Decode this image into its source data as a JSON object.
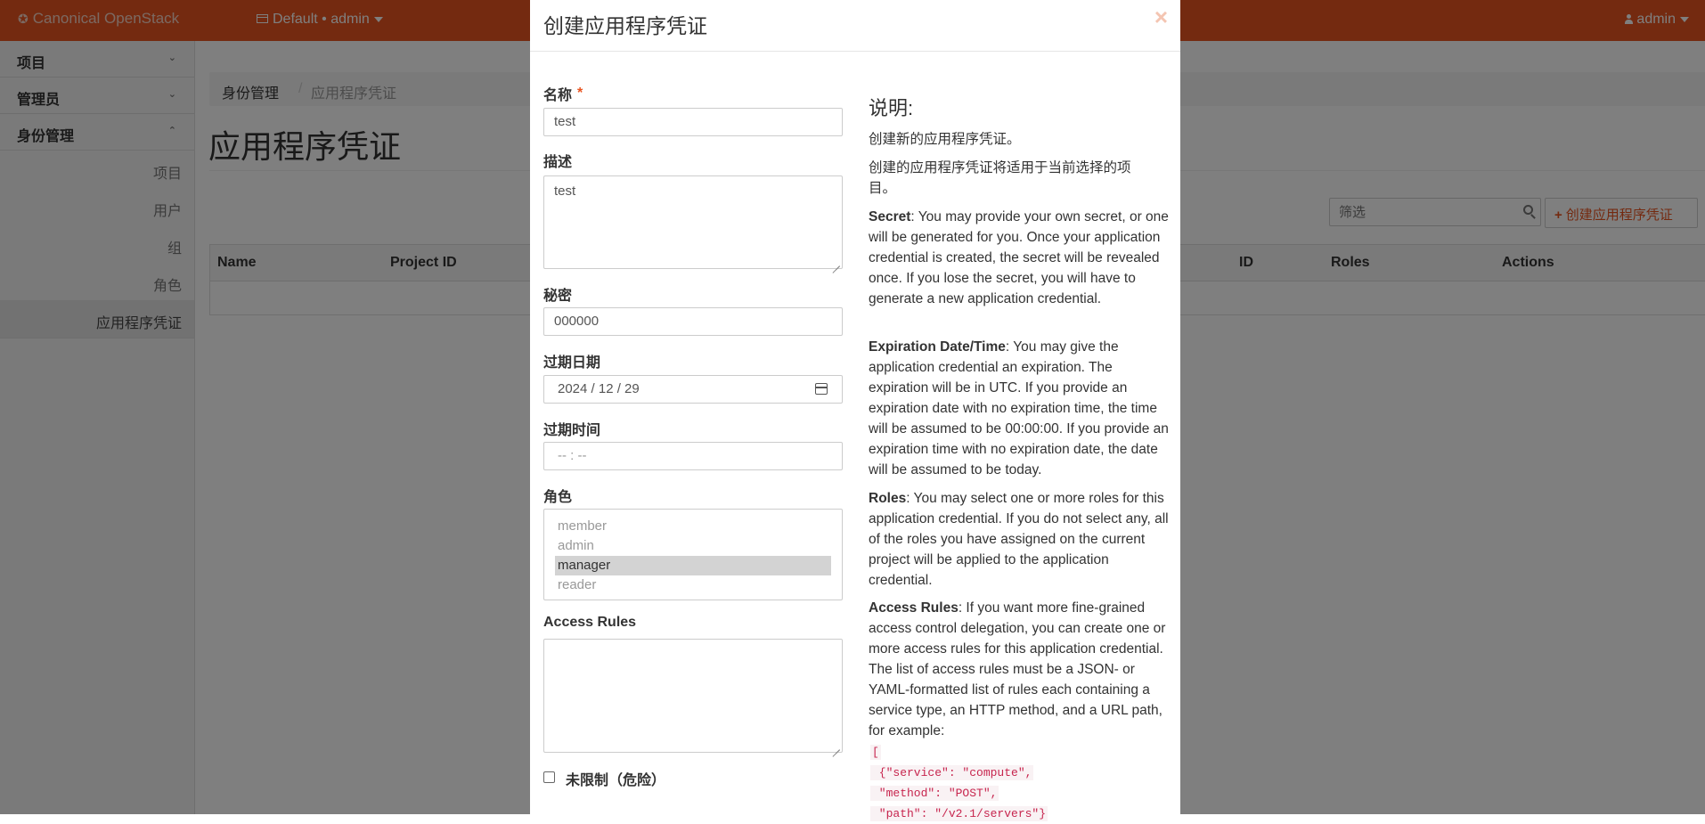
{
  "navbar": {
    "brand": "Canonical OpenStack",
    "project_switch": "Default • admin",
    "user": "admin"
  },
  "sidebar": {
    "sections": [
      {
        "label": "项目",
        "expanded": false
      },
      {
        "label": "管理员",
        "expanded": false
      },
      {
        "label": "身份管理",
        "expanded": true
      }
    ],
    "items": [
      {
        "label": "项目"
      },
      {
        "label": "用户"
      },
      {
        "label": "组"
      },
      {
        "label": "角色"
      },
      {
        "label": "应用程序凭证",
        "active": true
      }
    ]
  },
  "main": {
    "breadcrumb": [
      "身份管理",
      "/",
      "应用程序凭证"
    ],
    "page_title": "应用程序凭证",
    "filter_placeholder": "筛选",
    "create_button": "创建应用程序凭证",
    "table_headers": [
      "Name",
      "Project ID",
      "ID",
      "Roles",
      "Actions"
    ]
  },
  "modal": {
    "title": "创建应用程序凭证",
    "close": "×",
    "fields": {
      "name_label": "名称",
      "required_mark": "*",
      "name_value": "test",
      "description_label": "描述",
      "description_value": "test",
      "secret_label": "秘密",
      "secret_value": "000000",
      "expiration_date_label": "过期日期",
      "expiration_date_value": "2024 / 12 / 29",
      "expiration_time_label": "过期时间",
      "expiration_time_placeholder": "-- : --",
      "roles_label": "角色",
      "roles": [
        "member",
        "admin",
        "manager",
        "reader"
      ],
      "selected_role": "manager",
      "access_rules_label": "Access Rules",
      "access_rules_value": "",
      "unrestricted_label": "未限制（危险）",
      "unrestricted_checked": false
    },
    "help": {
      "title": "说明:",
      "p1": "创建新的应用程序凭证。",
      "p2": "创建的应用程序凭证将适用于当前选择的项目。",
      "secret_term": "Secret",
      "secret_text": ": You may provide your own secret, or one will be generated for you. Once your application credential is created, the secret will be revealed once. If you lose the secret, you will have to generate a new application credential.",
      "expiration_term": "Expiration Date/Time",
      "expiration_text": ": You may give the application credential an expiration. The expiration will be in UTC. If you provide an expiration date with no expiration time, the time will be assumed to be 00:00:00. If you provide an expiration time with no expiration date, the date will be assumed to be today.",
      "roles_term": "Roles",
      "roles_text": ": You may select one or more roles for this application credential. If you do not select any, all of the roles you have assigned on the current project will be applied to the application credential.",
      "access_term": "Access Rules",
      "access_text": ": If you want more fine-grained access control delegation, you can create one or more access rules for this application credential. The list of access rules must be a JSON- or YAML-formatted list of rules each containing a service type, an HTTP method, and a URL path, for example:",
      "code_lines": [
        "[",
        " {\"service\": \"compute\",",
        " \"method\": \"POST\",",
        " \"path\": \"/v2.1/servers\"}"
      ]
    }
  },
  "colors": {
    "navbar": "#e95420",
    "accent": "#e95420",
    "overlay": "rgba(0,0,0,0.5)"
  }
}
